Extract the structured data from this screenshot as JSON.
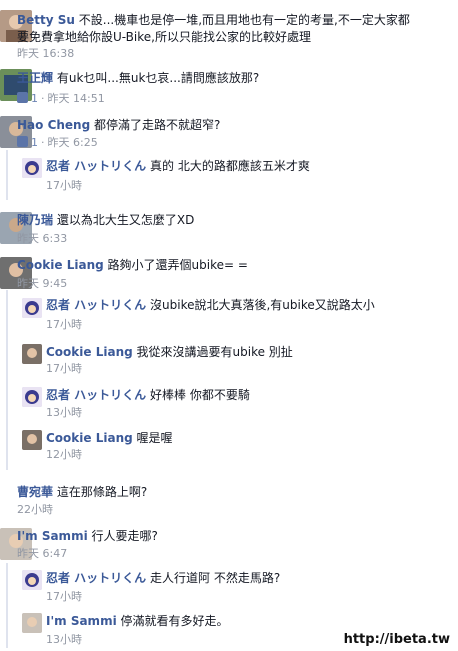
{
  "comments": [
    {
      "name": "Betty Su",
      "text_line1": "不設...機車也是停一堆,而且用地也有一定的考量,不一定大家都",
      "text_line2": "要免費拿地給你設U-Bike,所以只能找公家的比較好處理",
      "time": "昨天 16:38"
    },
    {
      "name": "王正輝",
      "text": "有uk乜叫...無uk乜哀...請問應該放那?",
      "likes": "1",
      "time": "昨天 14:51"
    },
    {
      "name": "Hao Cheng",
      "text": "都停滿了走路不就超窄?",
      "likes": "1",
      "time": "昨天 6:25"
    },
    {
      "name": "忍者 ハットリくん",
      "text": "真的 北大的路都應該五米才爽",
      "time": "17小時"
    },
    {
      "name": "陳乃瑞",
      "text": "還以為北大生又怎麼了XD",
      "time": "昨天 6:33"
    },
    {
      "name": "Cookie Liang",
      "text": "路夠小了還弄個ubike= =",
      "time": "昨天 9:45"
    },
    {
      "name": "忍者 ハットリくん",
      "text": "沒ubike說北大真落後,有ubike又說路太小",
      "time": "17小時"
    },
    {
      "name": "Cookie Liang",
      "text": "我從來沒講過要有ubike 別扯",
      "time": "17小時"
    },
    {
      "name": "忍者 ハットリくん",
      "text": "好棒棒 你都不要騎",
      "time": "13小時"
    },
    {
      "name": "Cookie Liang",
      "text": "喔是喔",
      "time": "12小時"
    },
    {
      "name": "曹宛華",
      "text": "這在那條路上啊?",
      "time": "22小時"
    },
    {
      "name": "I'm Sammi",
      "text": "行人要走哪?",
      "time": "昨天 6:47"
    },
    {
      "name": "忍者 ハットリくん",
      "text": "走人行道阿 不然走馬路?",
      "time": "17小時"
    },
    {
      "name": "I'm Sammi",
      "text": "停滿就看有多好走。",
      "time": "13小時"
    }
  ],
  "watermark": "http://ibeta.tw"
}
